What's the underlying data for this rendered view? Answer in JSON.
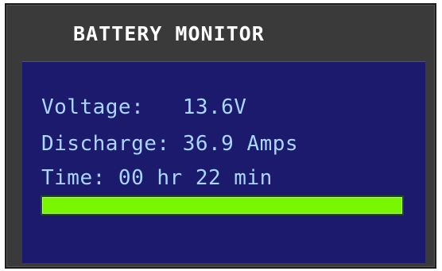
{
  "panel": {
    "title": "BATTERY MONITOR",
    "voltage_label": "Voltage:   ",
    "voltage_value": "13.6V",
    "discharge_label": "Discharge: ",
    "discharge_value": "36.9 Amps",
    "time_text": "Time: 00 hr 22 min",
    "charge_level_percent": 100,
    "colors": {
      "bezel": "#3a3a3a",
      "screen": "#1b1a6c",
      "text": "#a9d6ff",
      "bar": "#77f600"
    }
  }
}
